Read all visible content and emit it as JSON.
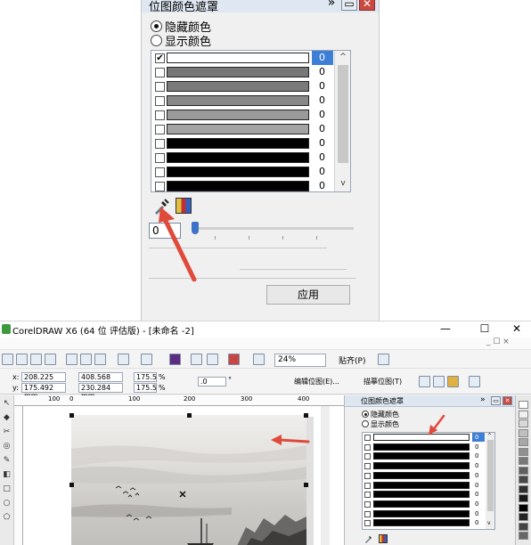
{
  "zoomed_docker": {
    "title": "位图颜色遮罩",
    "expand_glyph": "»",
    "minimize_glyph": "▭",
    "close_glyph": "✕",
    "radio_hide": "隐藏颜色",
    "radio_show": "显示颜色",
    "selected_radio": "hide",
    "rows": [
      {
        "checked": true,
        "color": "#ffffff",
        "value": "0",
        "selected": true
      },
      {
        "checked": false,
        "color": "#777777",
        "value": "0"
      },
      {
        "checked": false,
        "color": "#7a7a7a",
        "value": "0"
      },
      {
        "checked": false,
        "color": "#888888",
        "value": "0"
      },
      {
        "checked": false,
        "color": "#9a9a9a",
        "value": "0"
      },
      {
        "checked": false,
        "color": "#a3a3a3",
        "value": "0"
      },
      {
        "checked": false,
        "color": "#000000",
        "value": "0"
      },
      {
        "checked": false,
        "color": "#000000",
        "value": "0"
      },
      {
        "checked": false,
        "color": "#000000",
        "value": "0"
      },
      {
        "checked": false,
        "color": "#000000",
        "value": "0"
      }
    ],
    "scroll_up": "^",
    "scroll_down": "v",
    "tolerance_value": "0",
    "apply_label": "应用"
  },
  "app": {
    "title": "CorelDRAW X6 (64 位 评估版) - [未命名 -2]",
    "window_minimize": "—",
    "window_maximize": "☐",
    "window_close": "✕",
    "menu_right": "_ ☐ ×",
    "zoom_level": "24%",
    "snap_label": "贴齐(P)",
    "x_label": "x:",
    "x_value": "208.225 mm",
    "y_label": "y:",
    "y_value": "175.492 mm",
    "width_value": "408.568 mm",
    "height_value": "230.284 mm",
    "scale_w": "175.5",
    "scale_h": "175.5",
    "percent": "%",
    "rotation": ".0",
    "degree": "°",
    "edit_bitmap": "编辑位图(E)...",
    "trace_bitmap": "描摹位图(T)",
    "ruler_ticks": [
      "100",
      "0",
      "100",
      "200",
      "300",
      "400"
    ]
  },
  "docker": {
    "title": "位图颜色遮罩",
    "expand_glyph": "»",
    "minimize_glyph": "▭",
    "close_glyph": "✕",
    "radio_hide": "隐藏颜色",
    "radio_show": "显示颜色",
    "rows": [
      {
        "color": "#ffffff",
        "value": "0",
        "selected": true
      },
      {
        "color": "#000000",
        "value": "0"
      },
      {
        "color": "#000000",
        "value": "0"
      },
      {
        "color": "#000000",
        "value": "0"
      },
      {
        "color": "#000000",
        "value": "0"
      },
      {
        "color": "#000000",
        "value": "0"
      },
      {
        "color": "#000000",
        "value": "0"
      },
      {
        "color": "#000000",
        "value": "0"
      },
      {
        "color": "#000000",
        "value": "0"
      },
      {
        "color": "#000000",
        "value": "0"
      }
    ],
    "scroll_up": "^",
    "scroll_down": "v"
  },
  "palette_colors": [
    "#ffffff",
    "#f0f0f0",
    "#d8d8d8",
    "#c0c0c0",
    "#a8a8a8",
    "#909090",
    "#787878",
    "#606060",
    "#484848",
    "#303030",
    "#181818",
    "#000000",
    "#222222",
    "#444444",
    "#666666"
  ],
  "accent_color": "#3d7fd6",
  "annotation_color": "#e04a3a"
}
